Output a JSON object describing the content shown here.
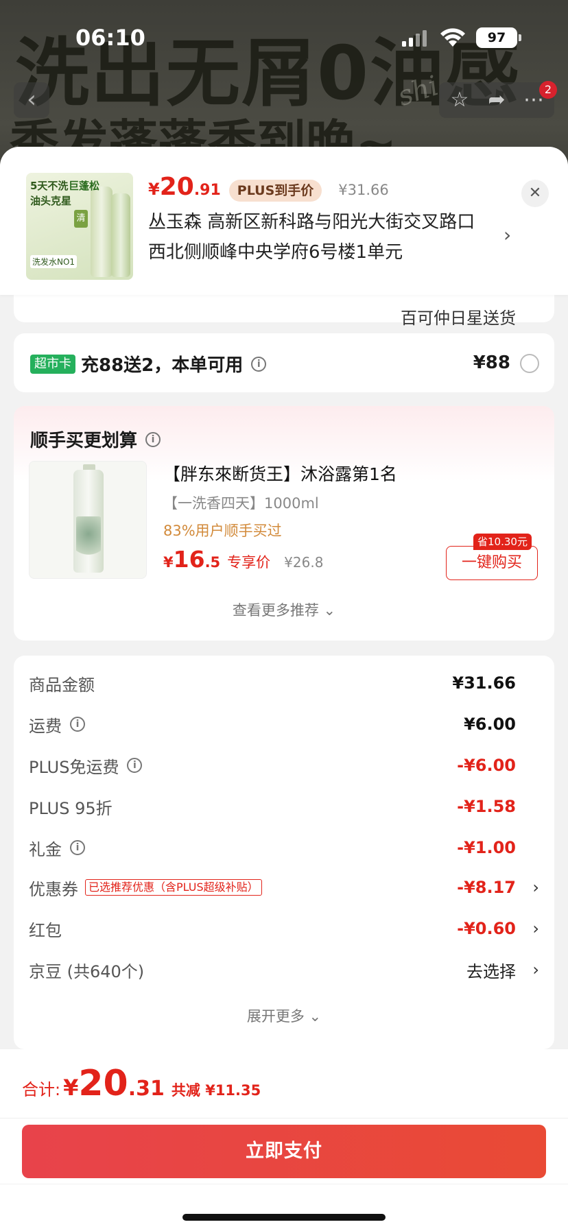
{
  "status_bar": {
    "time": "06:10",
    "battery": "97"
  },
  "banner": {
    "line1": "洗出无屑0油感",
    "line2": "秀发蓬蓬香到晚~",
    "script_mark": "shi"
  },
  "nav": {
    "back_icon": "chevron-left-icon",
    "badge": "2"
  },
  "product": {
    "thumb_text": [
      "5天不洗",
      "巨蓬松",
      "油头克星",
      "洗发水NO1",
      "清"
    ],
    "price_symbol": "¥",
    "price_int": "20",
    "price_dec": ".91",
    "plus_label": "PLUS到手价",
    "old_price": "¥31.66",
    "address": "丛玉森  高新区新科路与阳光大街交叉路口西北侧顺峰中央学府6号楼1单元",
    "partial_text": "百可仲日星送货"
  },
  "supermarket": {
    "tag": "超市卡",
    "text": "充88送2，本单可用",
    "price": "¥88"
  },
  "recommend": {
    "title": "顺手买更划算",
    "item": {
      "name": "【胖东來断货王】沐浴露第1名",
      "sub": "【一洗香四天】1000ml",
      "buyers": "83%用户顺手买过",
      "price_symbol": "¥",
      "price_int": "16",
      "price_dec": ".5",
      "exclusive": "专享价",
      "old_price": "¥26.8",
      "save_tag": "省10.30元",
      "buy_label": "一键购买"
    },
    "more_label": "查看更多推荐 ⌄"
  },
  "summary": {
    "rows": [
      {
        "label": "商品金额",
        "value": "¥31.66"
      },
      {
        "label": "运费",
        "value": "¥6.00"
      },
      {
        "label": "PLUS免运费",
        "value": "-¥6.00"
      },
      {
        "label": "PLUS 95折",
        "value": "-¥1.58"
      },
      {
        "label": "礼金",
        "value": "-¥1.00"
      },
      {
        "label": "优惠券",
        "tag": "已选推荐优惠（含PLUS超级补贴）",
        "value": "-¥8.17"
      },
      {
        "label": "红包",
        "value": "-¥0.60"
      },
      {
        "label": "京豆 (共640个)",
        "value": "去选择"
      }
    ],
    "expand_label": "展开更多 ⌄"
  },
  "footer": {
    "total_label": "合计:",
    "total_symbol": "¥",
    "total_int": "20",
    "total_dec": ".31",
    "reduce_text": "共减 ¥11.35",
    "pay_label": "立即支付"
  },
  "colors": {
    "accent": "#e2231a",
    "green_tag": "#25b05c",
    "plus_bg": "#f7dfcf"
  }
}
